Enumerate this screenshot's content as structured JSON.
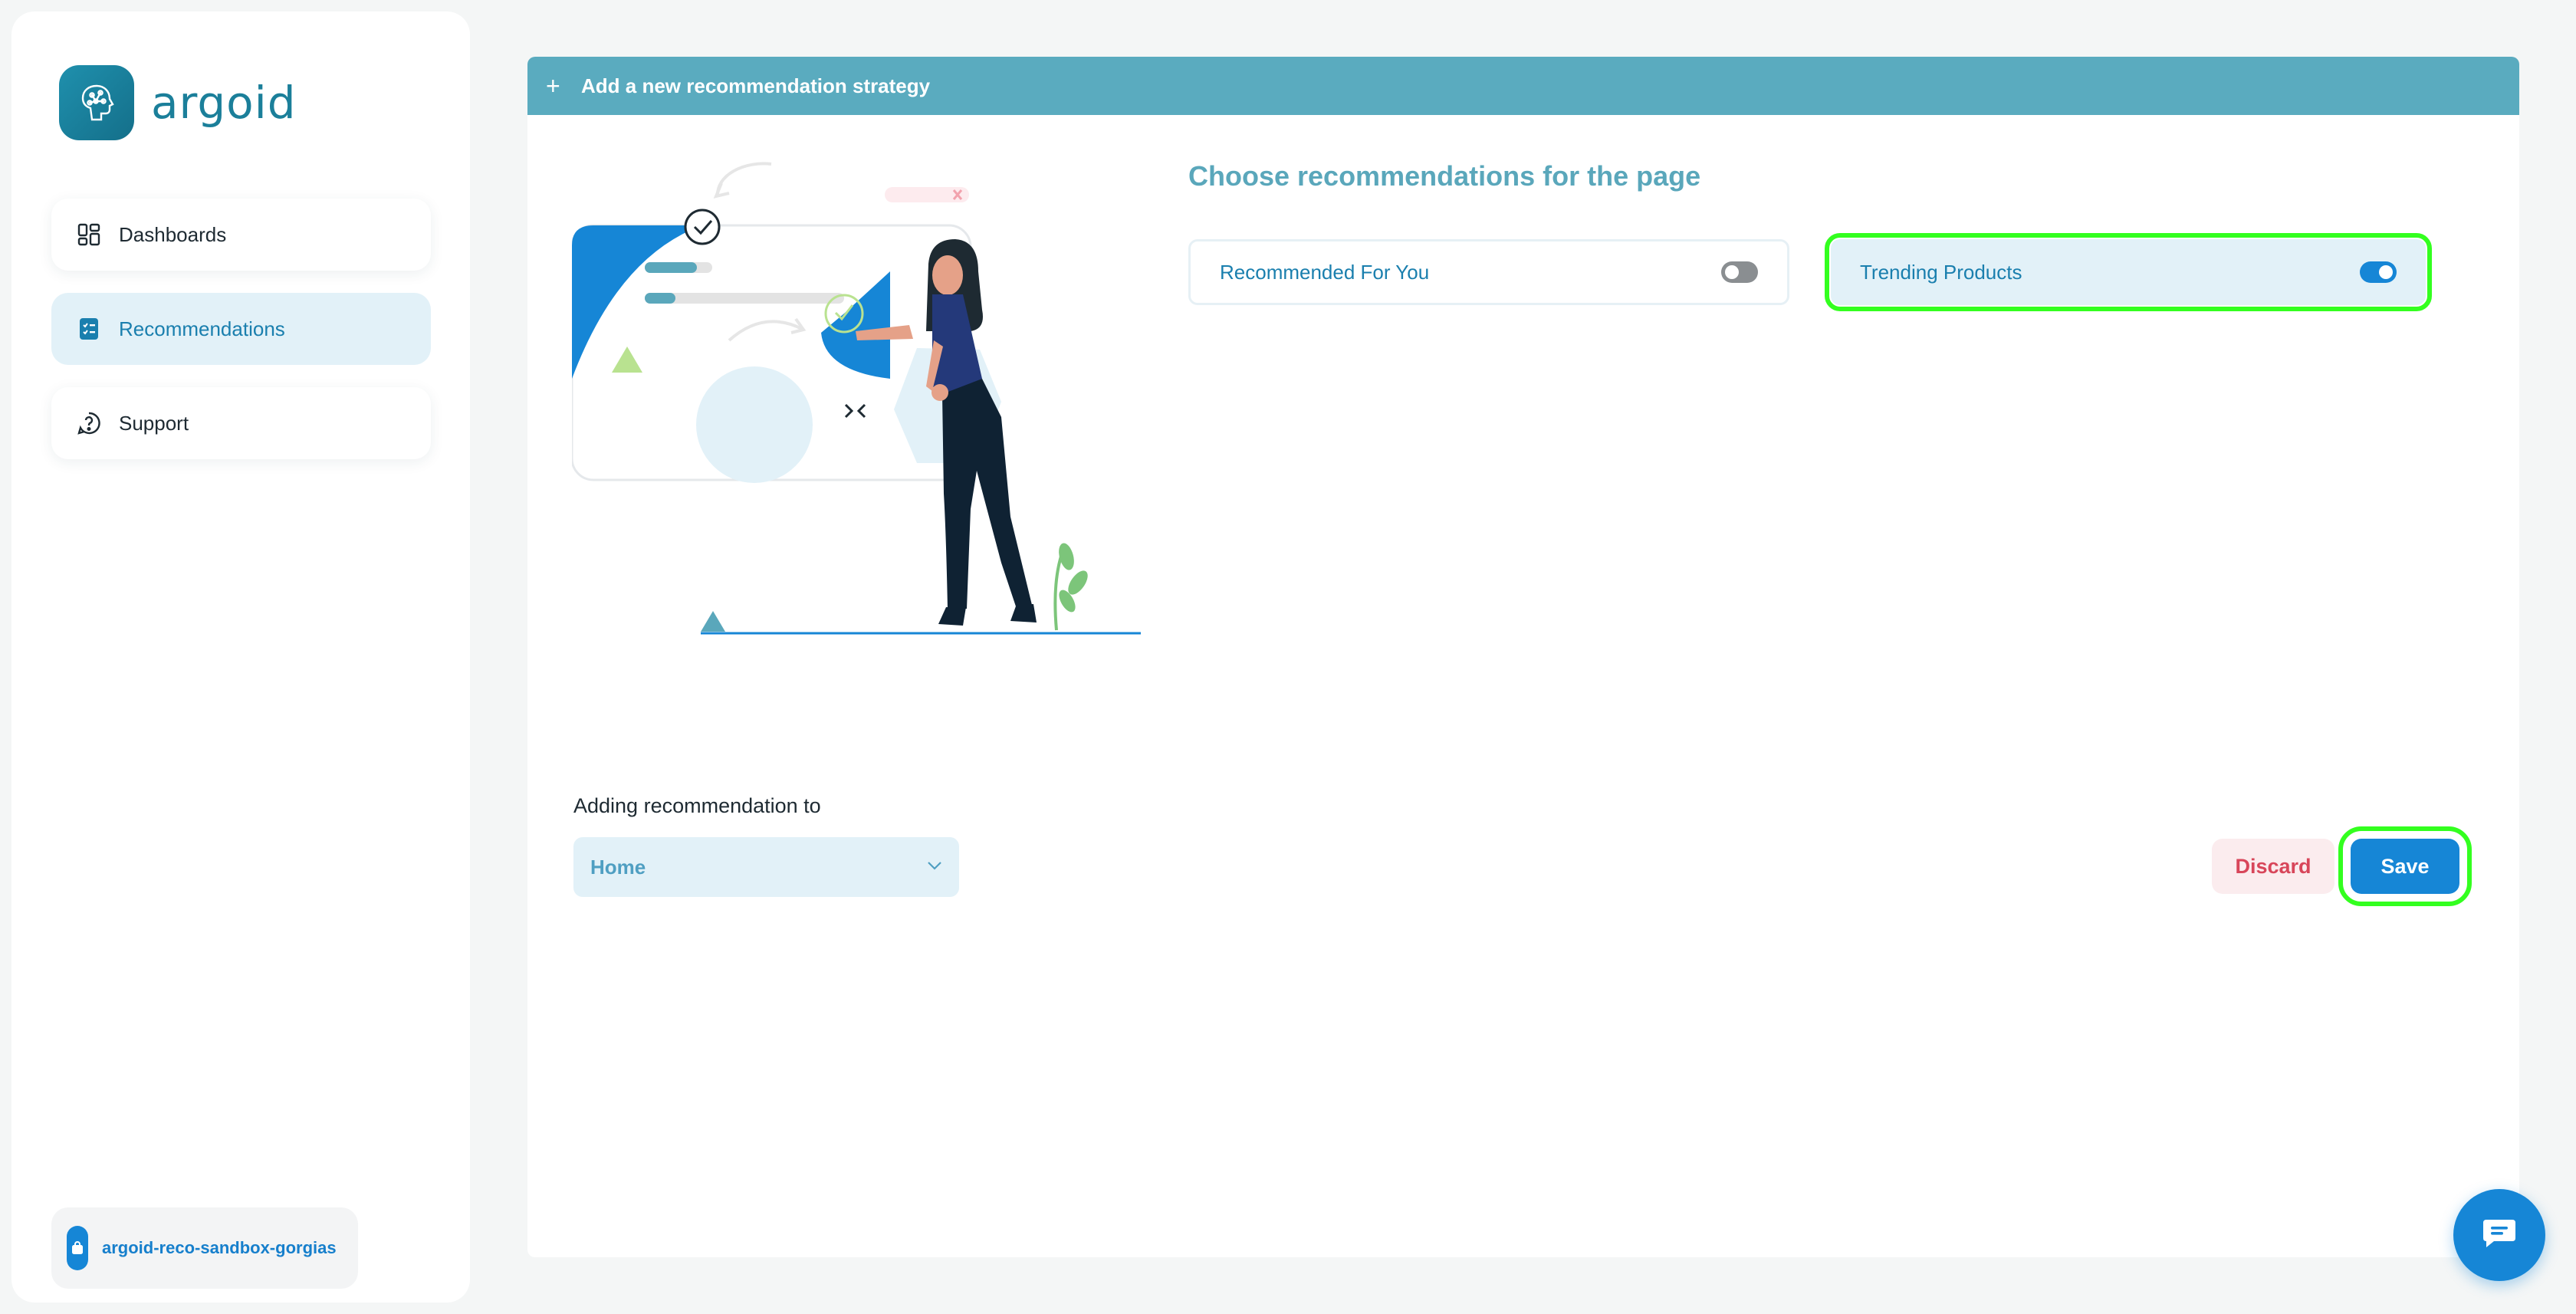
{
  "app": {
    "name": "argoid"
  },
  "sidebar": {
    "items": [
      {
        "label": "Dashboards",
        "icon": "dashboard-icon",
        "active": false
      },
      {
        "label": "Recommendations",
        "icon": "recommendations-icon",
        "active": true
      },
      {
        "label": "Support",
        "icon": "help-icon",
        "active": false
      }
    ],
    "store": {
      "label": "argoid-reco-sandbox-gorgias",
      "icon": "store-icon"
    }
  },
  "panel": {
    "header": {
      "title": "Add a new recommendation strategy",
      "icon": "plus-icon"
    },
    "section_title": "Choose recommendations for the page",
    "options": [
      {
        "label": "Recommended For You",
        "enabled": false
      },
      {
        "label": "Trending Products",
        "enabled": true
      }
    ],
    "target": {
      "label": "Adding recommendation to",
      "value": "Home"
    },
    "actions": {
      "discard": "Discard",
      "save": "Save"
    }
  },
  "chat": {
    "icon": "chat-icon"
  },
  "colors": {
    "brand": "#1b7f9a",
    "header": "#5aabbf",
    "primary": "#1686d6",
    "discard": "#d8465a",
    "highlight": "#33ff1f"
  }
}
